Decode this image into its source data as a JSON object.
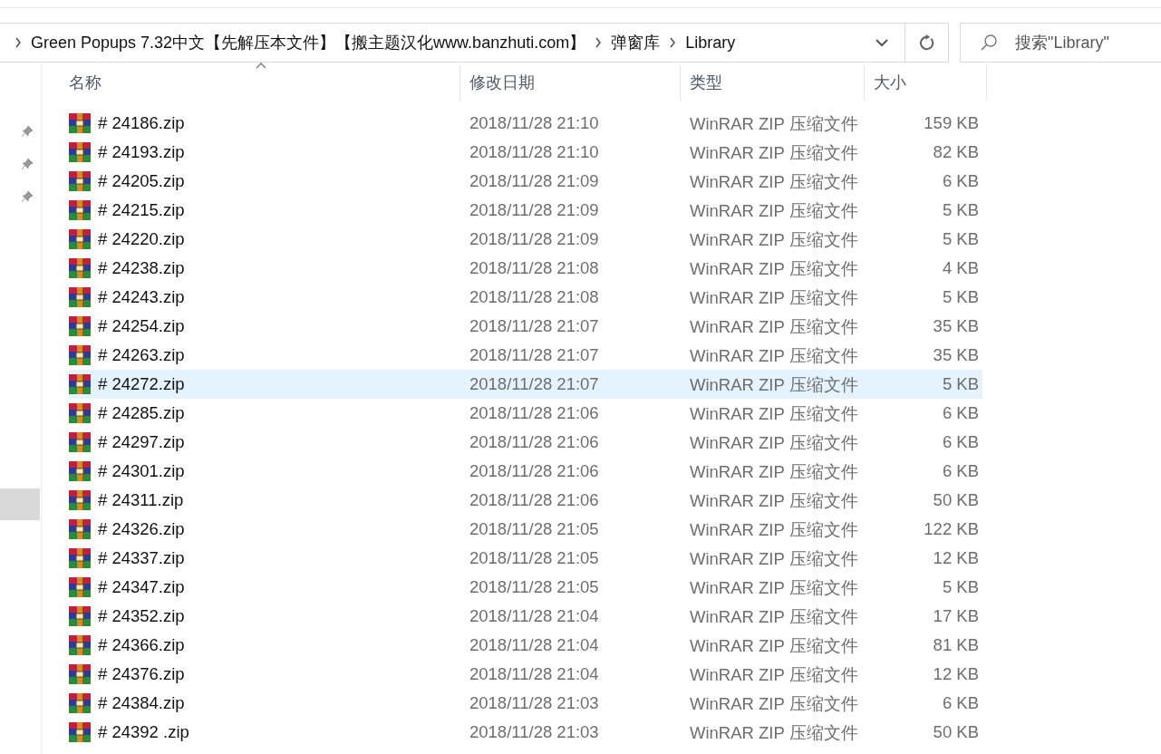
{
  "address_bar": {
    "breadcrumbs": [
      "Green Popups 7.32中文【先解压本文件】【搬主题汉化www.banzhuti.com】",
      "弹窗库",
      "Library"
    ]
  },
  "search": {
    "placeholder": "搜索\"Library\""
  },
  "table": {
    "columns": [
      {
        "label": "名称",
        "sorted": true
      },
      {
        "label": "修改日期",
        "sorted": false
      },
      {
        "label": "类型",
        "sorted": false
      },
      {
        "label": "大小",
        "sorted": false
      }
    ],
    "rows": [
      {
        "name": "# 24186.zip",
        "date": "2018/11/28 21:10",
        "type": "WinRAR ZIP 压缩文件",
        "size": "159 KB",
        "selected": false
      },
      {
        "name": "# 24193.zip",
        "date": "2018/11/28 21:10",
        "type": "WinRAR ZIP 压缩文件",
        "size": "82 KB",
        "selected": false
      },
      {
        "name": "# 24205.zip",
        "date": "2018/11/28 21:09",
        "type": "WinRAR ZIP 压缩文件",
        "size": "6 KB",
        "selected": false
      },
      {
        "name": "# 24215.zip",
        "date": "2018/11/28 21:09",
        "type": "WinRAR ZIP 压缩文件",
        "size": "5 KB",
        "selected": false
      },
      {
        "name": "# 24220.zip",
        "date": "2018/11/28 21:09",
        "type": "WinRAR ZIP 压缩文件",
        "size": "5 KB",
        "selected": false
      },
      {
        "name": "# 24238.zip",
        "date": "2018/11/28 21:08",
        "type": "WinRAR ZIP 压缩文件",
        "size": "4 KB",
        "selected": false
      },
      {
        "name": "# 24243.zip",
        "date": "2018/11/28 21:08",
        "type": "WinRAR ZIP 压缩文件",
        "size": "5 KB",
        "selected": false
      },
      {
        "name": "# 24254.zip",
        "date": "2018/11/28 21:07",
        "type": "WinRAR ZIP 压缩文件",
        "size": "35 KB",
        "selected": false
      },
      {
        "name": "# 24263.zip",
        "date": "2018/11/28 21:07",
        "type": "WinRAR ZIP 压缩文件",
        "size": "35 KB",
        "selected": false
      },
      {
        "name": "# 24272.zip",
        "date": "2018/11/28 21:07",
        "type": "WinRAR ZIP 压缩文件",
        "size": "5 KB",
        "selected": true
      },
      {
        "name": "# 24285.zip",
        "date": "2018/11/28 21:06",
        "type": "WinRAR ZIP 压缩文件",
        "size": "6 KB",
        "selected": false
      },
      {
        "name": "# 24297.zip",
        "date": "2018/11/28 21:06",
        "type": "WinRAR ZIP 压缩文件",
        "size": "6 KB",
        "selected": false
      },
      {
        "name": "# 24301.zip",
        "date": "2018/11/28 21:06",
        "type": "WinRAR ZIP 压缩文件",
        "size": "6 KB",
        "selected": false
      },
      {
        "name": "# 24311.zip",
        "date": "2018/11/28 21:06",
        "type": "WinRAR ZIP 压缩文件",
        "size": "50 KB",
        "selected": false
      },
      {
        "name": "# 24326.zip",
        "date": "2018/11/28 21:05",
        "type": "WinRAR ZIP 压缩文件",
        "size": "122 KB",
        "selected": false
      },
      {
        "name": "# 24337.zip",
        "date": "2018/11/28 21:05",
        "type": "WinRAR ZIP 压缩文件",
        "size": "12 KB",
        "selected": false
      },
      {
        "name": "# 24347.zip",
        "date": "2018/11/28 21:05",
        "type": "WinRAR ZIP 压缩文件",
        "size": "5 KB",
        "selected": false
      },
      {
        "name": "# 24352.zip",
        "date": "2018/11/28 21:04",
        "type": "WinRAR ZIP 压缩文件",
        "size": "17 KB",
        "selected": false
      },
      {
        "name": "# 24366.zip",
        "date": "2018/11/28 21:04",
        "type": "WinRAR ZIP 压缩文件",
        "size": "81 KB",
        "selected": false
      },
      {
        "name": "# 24376.zip",
        "date": "2018/11/28 21:04",
        "type": "WinRAR ZIP 压缩文件",
        "size": "12 KB",
        "selected": false
      },
      {
        "name": "# 24384.zip",
        "date": "2018/11/28 21:03",
        "type": "WinRAR ZIP 压缩文件",
        "size": "6 KB",
        "selected": false
      },
      {
        "name": "# 24392 .zip",
        "date": "2018/11/28 21:03",
        "type": "WinRAR ZIP 压缩文件",
        "size": "50 KB",
        "selected": false
      }
    ]
  }
}
